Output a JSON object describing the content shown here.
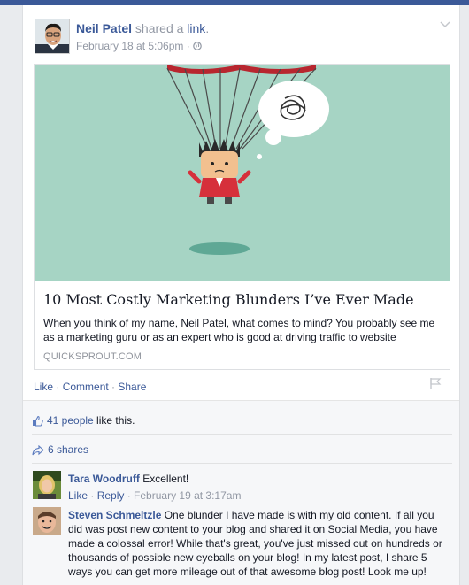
{
  "post": {
    "author": "Neil Patel",
    "action_text": " shared a ",
    "action_link": "link",
    "action_end": ".",
    "timestamp": "February 18 at 5:06pm",
    "separator": " · ",
    "privacy_icon": "globe-icon"
  },
  "share": {
    "title": "10 Most Costly Marketing Blunders I’ve Ever Made",
    "description": "When you think of my name, Neil Patel, what comes to mind? You probably see me as a marketing guru or as an expert who is good at driving traffic to website",
    "domain": "QUICKSPROUT.COM"
  },
  "actions": {
    "like": "Like",
    "comment": "Comment",
    "share": "Share",
    "dot": " · "
  },
  "likes": {
    "count_text": "41 people",
    "suffix": " like this."
  },
  "shares": {
    "text": "6 shares"
  },
  "comments": [
    {
      "author": "Tara Woodruff",
      "text": " Excellent!",
      "like": "Like",
      "reply": "Reply",
      "dot": " · ",
      "time": "February 19 at 3:17am"
    },
    {
      "author": "Steven Schmeltzle",
      "text": " One blunder I have made is with my old content. If all you did was post new content to your blog and shared it on Social Media, you have made a colossal error! While that's great, you've just missed out on hundreds or thousands of possible new eyeballs on your blog! In my latest post, I share 5 ways you can get more mileage out of that awesome blog post! Look me up!"
    }
  ],
  "colors": {
    "facebook_blue": "#3b5998",
    "meta_gray": "#9197a3",
    "image_bg": "#a6d4c4"
  }
}
